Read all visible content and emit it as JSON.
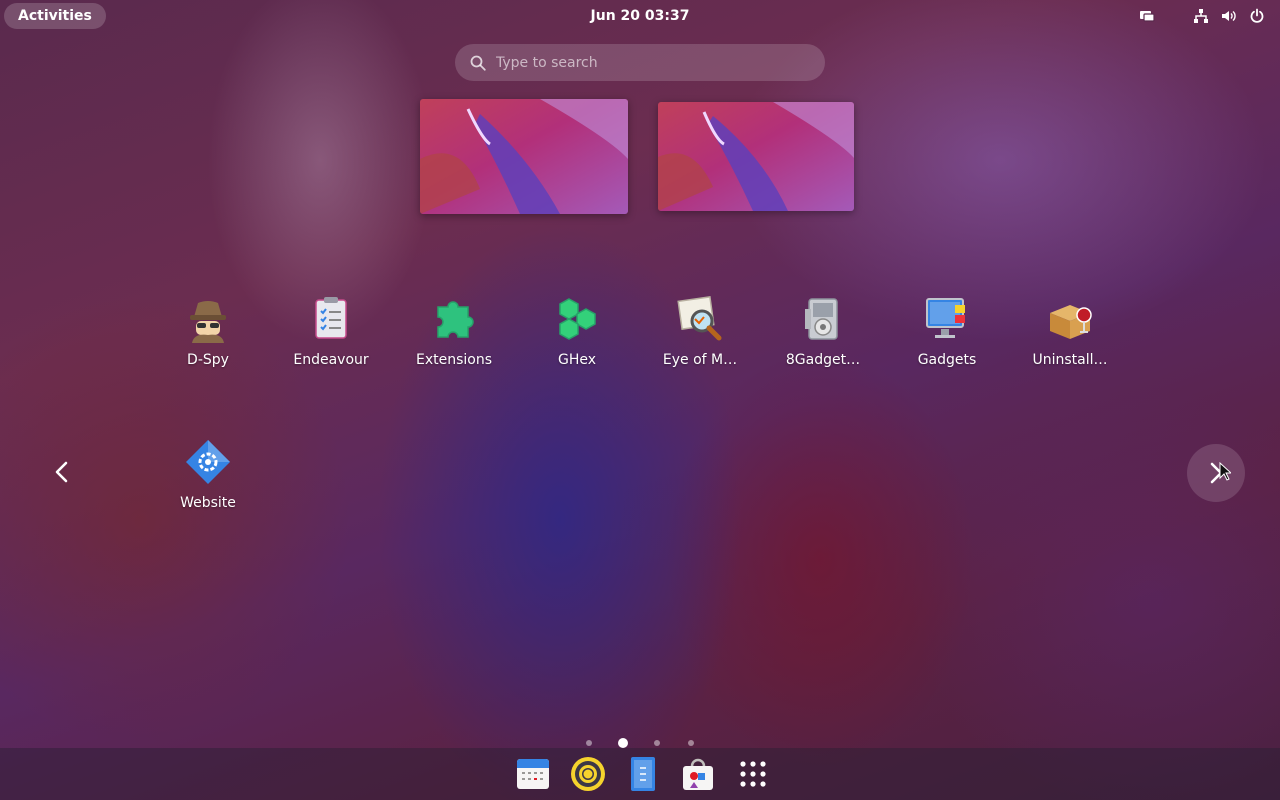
{
  "topbar": {
    "activities_label": "Activities",
    "clock": "Jun 20  03:37",
    "tray_icons": [
      "screen-share-icon",
      "network-icon",
      "volume-icon",
      "power-icon"
    ]
  },
  "search": {
    "placeholder": "Type to search",
    "value": ""
  },
  "workspaces": [
    {
      "name": "workspace-1-thumbnail"
    },
    {
      "name": "workspace-2-thumbnail"
    }
  ],
  "apps": [
    {
      "label": "D-Spy",
      "icon": "spy-icon"
    },
    {
      "label": "Endeavour",
      "icon": "clipboard-icon"
    },
    {
      "label": "Extensions",
      "icon": "puzzle-icon"
    },
    {
      "label": "GHex",
      "icon": "hexagon-icon"
    },
    {
      "label": "Eye of M…",
      "icon": "magnifier-icon"
    },
    {
      "label": "8Gadget…",
      "icon": "gadget-pack-icon"
    },
    {
      "label": "Gadgets",
      "icon": "monitor-gadgets-icon"
    },
    {
      "label": "Uninstall…",
      "icon": "wine-box-icon"
    },
    {
      "label": "Website",
      "icon": "web-diamond-icon"
    }
  ],
  "pagination": {
    "pages": 4,
    "current": 2
  },
  "dash": [
    {
      "name": "calendar-app",
      "icon": "calendar-icon"
    },
    {
      "name": "music-player-app",
      "icon": "disc-icon"
    },
    {
      "name": "text-editor-app",
      "icon": "document-icon"
    },
    {
      "name": "software-app",
      "icon": "bag-icon"
    },
    {
      "name": "show-apps",
      "icon": "grid-icon"
    }
  ],
  "colors": {
    "accent_green": "#2ec27e",
    "blue": "#3584e4",
    "yellow": "#f6d32d"
  }
}
